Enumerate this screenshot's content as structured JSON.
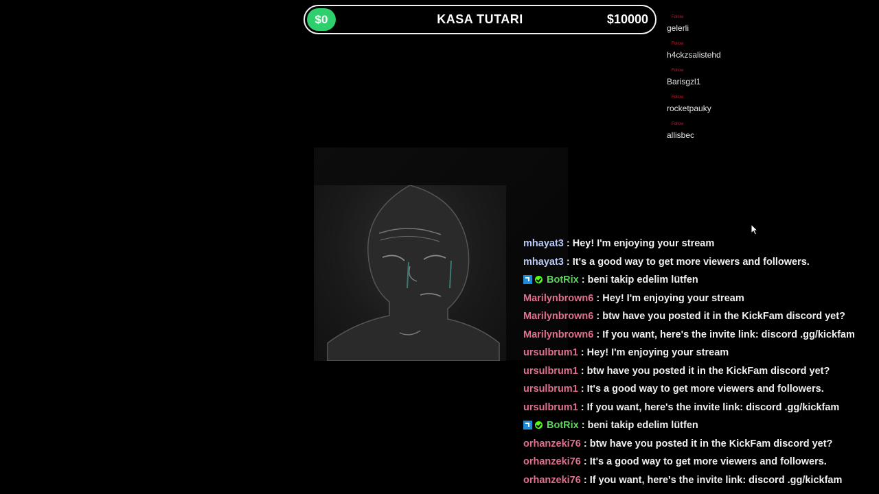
{
  "donation_bar": {
    "current": "$0",
    "title": "KASA TUTARI",
    "goal": "$10000",
    "progress_fraction": 0,
    "fill_color": "#2fcf6e"
  },
  "followers": [
    {
      "tag": "Follow",
      "name": "gelerli"
    },
    {
      "tag": "Follow",
      "name": "h4ckzsalistehd"
    },
    {
      "tag": "Follow",
      "name": "Barisgzl1"
    },
    {
      "tag": "Follow",
      "name": "rocketpauky"
    },
    {
      "tag": "Follow",
      "name": "allisbec"
    }
  ],
  "chat": [
    {
      "user": "mhayat3",
      "color": "#b9cbf5",
      "message": ": Hey! I'm enjoying your stream",
      "badges": false
    },
    {
      "user": "mhayat3",
      "color": "#b9cbf5",
      "message": ": It's a good way to get more viewers and followers.",
      "badges": false
    },
    {
      "user": "BotRix",
      "color": "#5fd35f",
      "message": ": beni takip edelim lütfen",
      "badges": true
    },
    {
      "user": "Marilynbrown6",
      "color": "#e0708e",
      "message": ": Hey! I'm enjoying your stream",
      "badges": false
    },
    {
      "user": "Marilynbrown6",
      "color": "#e0708e",
      "message": ": btw have you posted it in the KickFam discord yet?",
      "badges": false
    },
    {
      "user": "Marilynbrown6",
      "color": "#e0708e",
      "message": ": If you want, here's the invite link: discord .gg/kickfam",
      "badges": false
    },
    {
      "user": "ursulbrum1",
      "color": "#e0708e",
      "message": ": Hey! I'm enjoying your stream",
      "badges": false
    },
    {
      "user": "ursulbrum1",
      "color": "#e0708e",
      "message": ": btw have you posted it in the KickFam discord yet?",
      "badges": false
    },
    {
      "user": "ursulbrum1",
      "color": "#e0708e",
      "message": ": It's a good way to get more viewers and followers.",
      "badges": false
    },
    {
      "user": "ursulbrum1",
      "color": "#e0708e",
      "message": ": If you want, here's the invite link: discord .gg/kickfam",
      "badges": false
    },
    {
      "user": "BotRix",
      "color": "#5fd35f",
      "message": ": beni takip edelim lütfen",
      "badges": true
    },
    {
      "user": "orhanzeki76",
      "color": "#e0708e",
      "message": ": btw have you posted it in the KickFam discord yet?",
      "badges": false
    },
    {
      "user": "orhanzeki76",
      "color": "#e0708e",
      "message": ": It's a good way to get more viewers and followers.",
      "badges": false
    },
    {
      "user": "orhanzeki76",
      "color": "#e0708e",
      "message": ": If you want, here's the invite link: discord .gg/kickfam",
      "badges": false
    }
  ],
  "icons": {
    "bot_badge": "bot-badge-icon",
    "verified_badge": "verified-check-icon",
    "cursor": "mouse-cursor-icon"
  }
}
